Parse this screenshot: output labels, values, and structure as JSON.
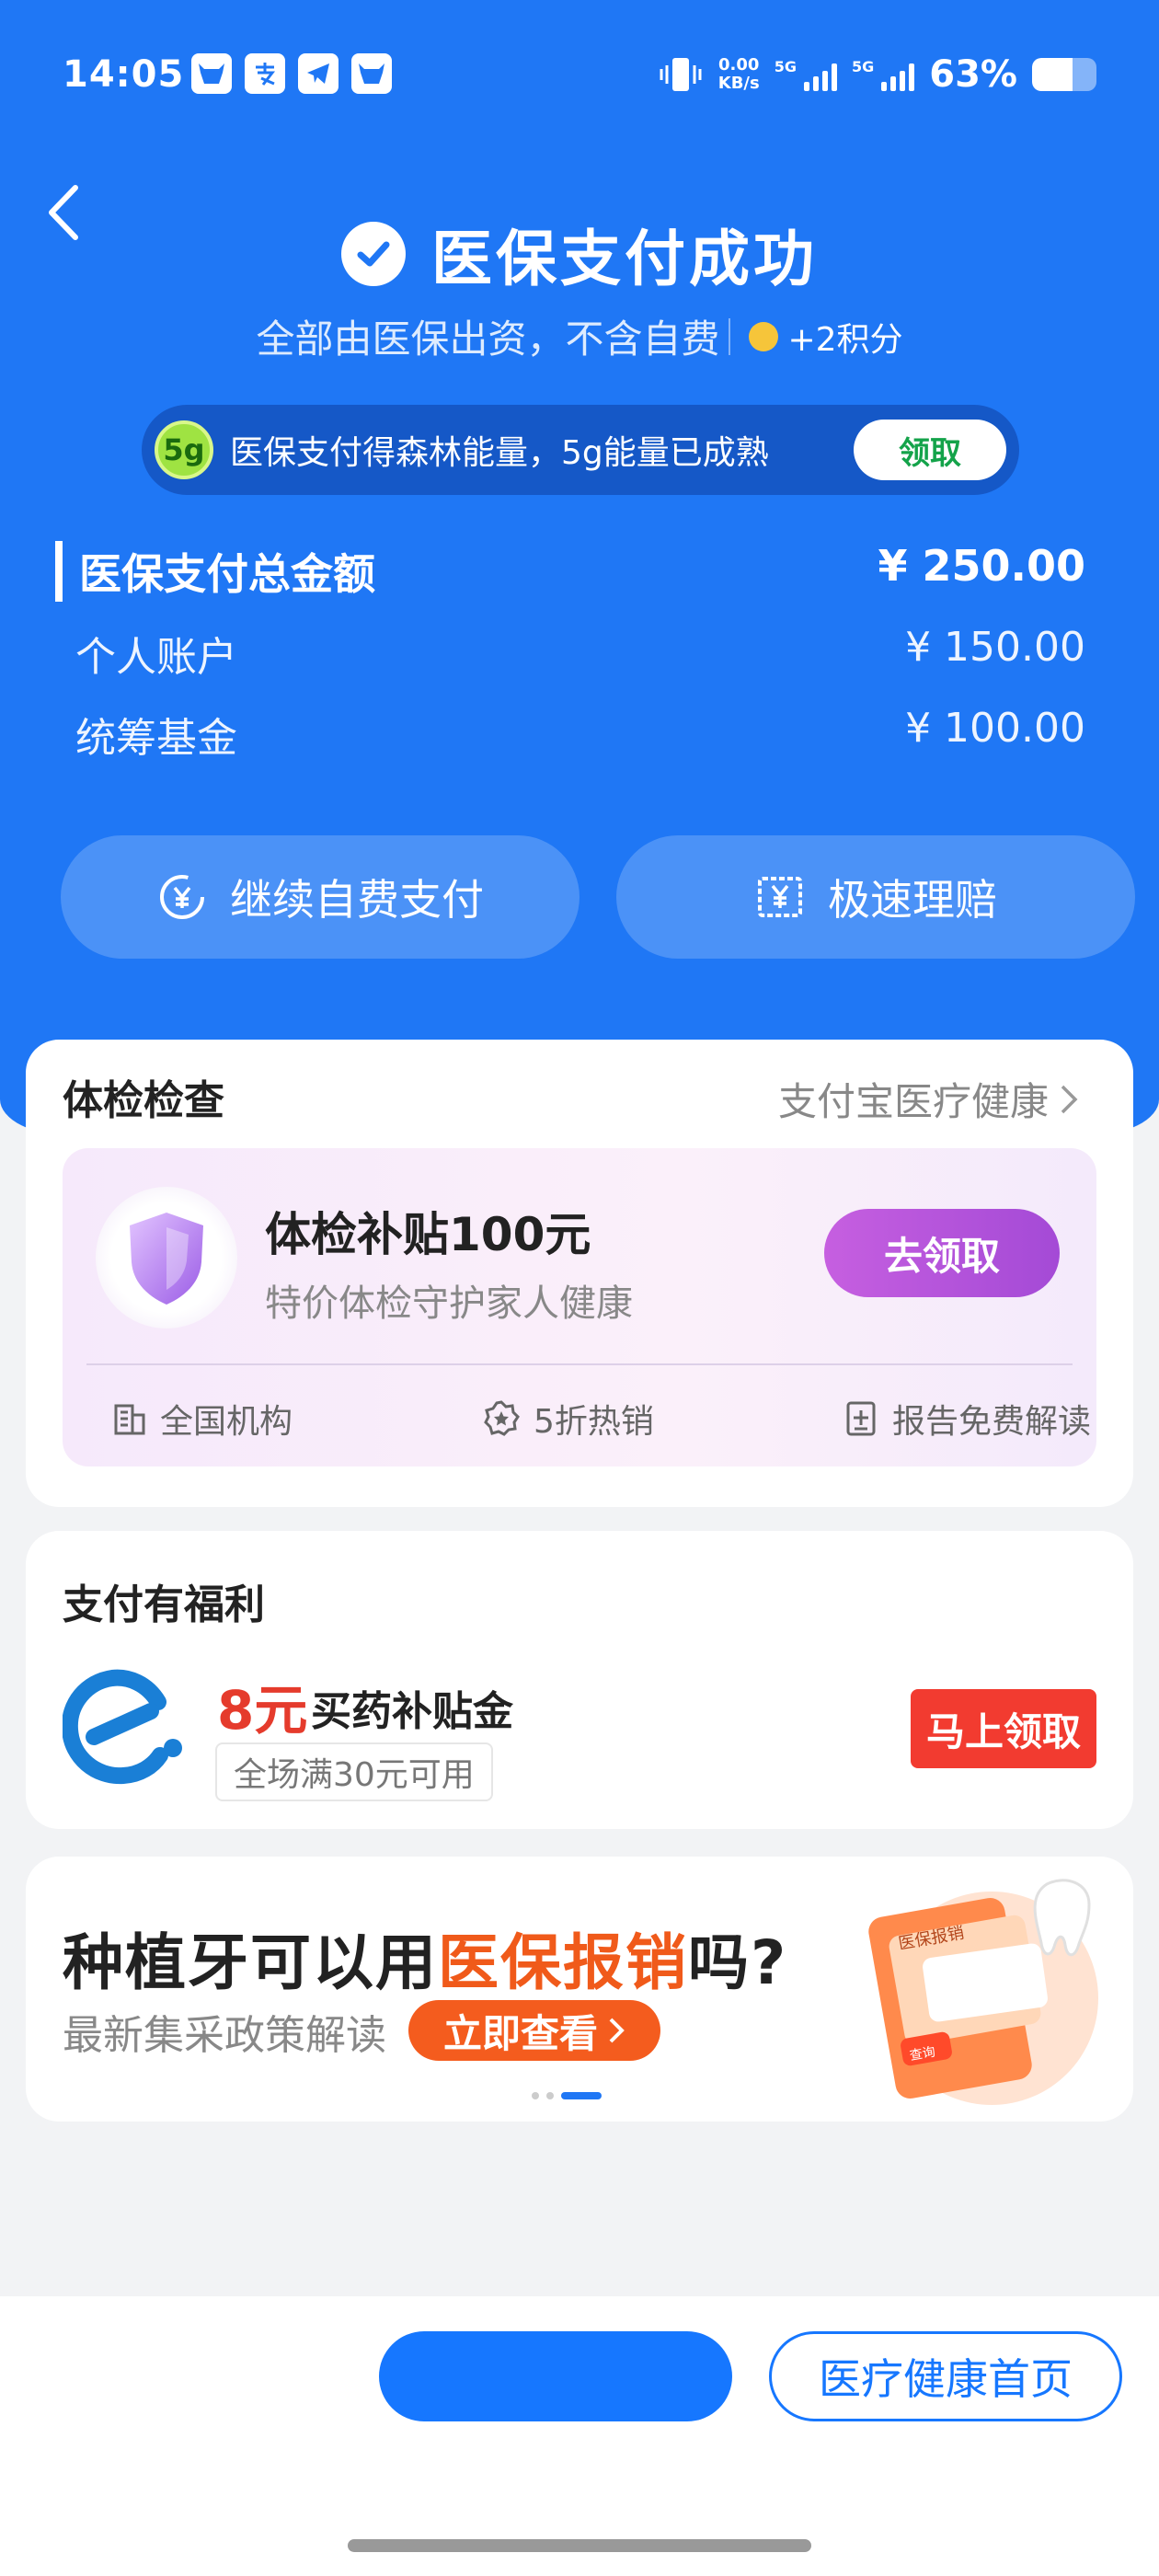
{
  "status_bar": {
    "time": "14:05",
    "net_speed_value": "0.00",
    "net_speed_unit": "KB/s",
    "signal1_label": "5G",
    "signal2_label": "5G",
    "battery_percent": "63%",
    "battery_level": 0.63,
    "app_icons": [
      "cow-icon",
      "alipay-icon",
      "telegram-icon",
      "cow-icon"
    ]
  },
  "header": {
    "title": "医保支付成功",
    "subtitle": "全部由医保出资，不含自费",
    "points": "+2积分"
  },
  "energy_banner": {
    "badge": "5g",
    "text": "医保支付得森林能量，5g能量已成熟",
    "button": "领取"
  },
  "amounts": {
    "total_label": "医保支付总金额",
    "total_value": "¥ 250.00",
    "personal_label": "个人账户",
    "personal_value": "¥ 150.00",
    "fund_label": "统筹基金",
    "fund_value": "¥ 100.00"
  },
  "actions": {
    "continue_pay": "继续自费支付",
    "fast_claim": "极速理赔"
  },
  "checkup_card": {
    "title": "体检检查",
    "link": "支付宝医疗健康",
    "promo_title": "体检补贴100元",
    "promo_sub": "特价体检守护家人健康",
    "promo_button": "去领取",
    "features": [
      "全国机构",
      "5折热销",
      "报告免费解读"
    ]
  },
  "benefit_card": {
    "title": "支付有福利",
    "amount": "8元",
    "name": "买药补贴金",
    "condition": "全场满30元可用",
    "button": "马上领取"
  },
  "ad_card": {
    "title_pre": "种植牙可以用",
    "title_highlight": "医保报销",
    "title_post": "吗?",
    "sub": "最新集采政策解读",
    "button": "立即查看",
    "art_label_top": "医保报销",
    "art_label_btn": "查询"
  },
  "bottom_bar": {
    "primary_button": "",
    "secondary_button": "医疗健康首页"
  },
  "colors": {
    "primary_blue": "#1f77f5",
    "green": "#14a34a",
    "purple": "#b052dc",
    "red": "#f23b30",
    "orange": "#f45c1e"
  }
}
